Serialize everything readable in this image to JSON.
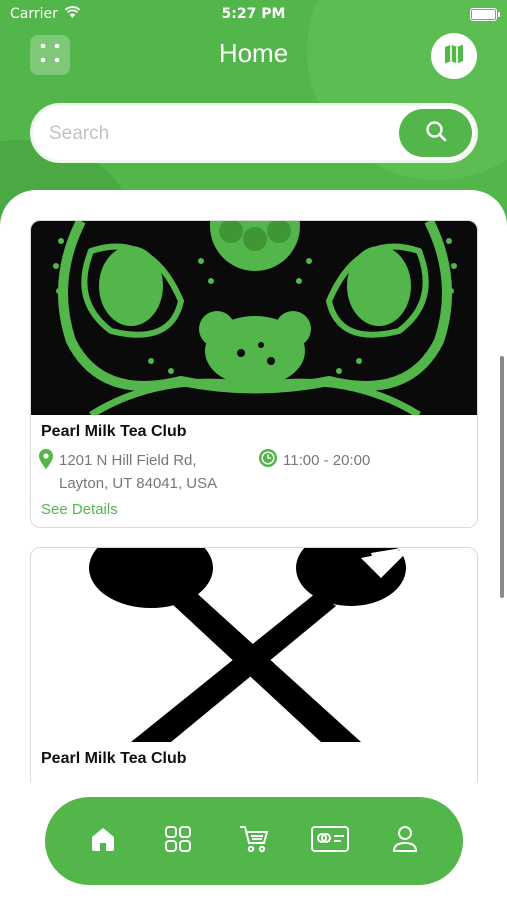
{
  "status_bar": {
    "carrier": "Carrier",
    "time": "5:27 PM"
  },
  "header": {
    "title": "Home"
  },
  "search": {
    "placeholder": "Search",
    "value": ""
  },
  "stores": [
    {
      "name": "Pearl Milk Tea Club",
      "address": "1201 N Hill Field Rd, Layton, UT 84041, USA",
      "hours": "11:00 - 20:00",
      "details_label": "See Details"
    },
    {
      "name": "Pearl Milk Tea Club"
    }
  ],
  "bottom_nav": {
    "items": [
      "home",
      "categories",
      "cart",
      "card",
      "profile"
    ],
    "active": "home"
  },
  "colors": {
    "accent": "#53b64a",
    "text_muted": "#777777"
  }
}
